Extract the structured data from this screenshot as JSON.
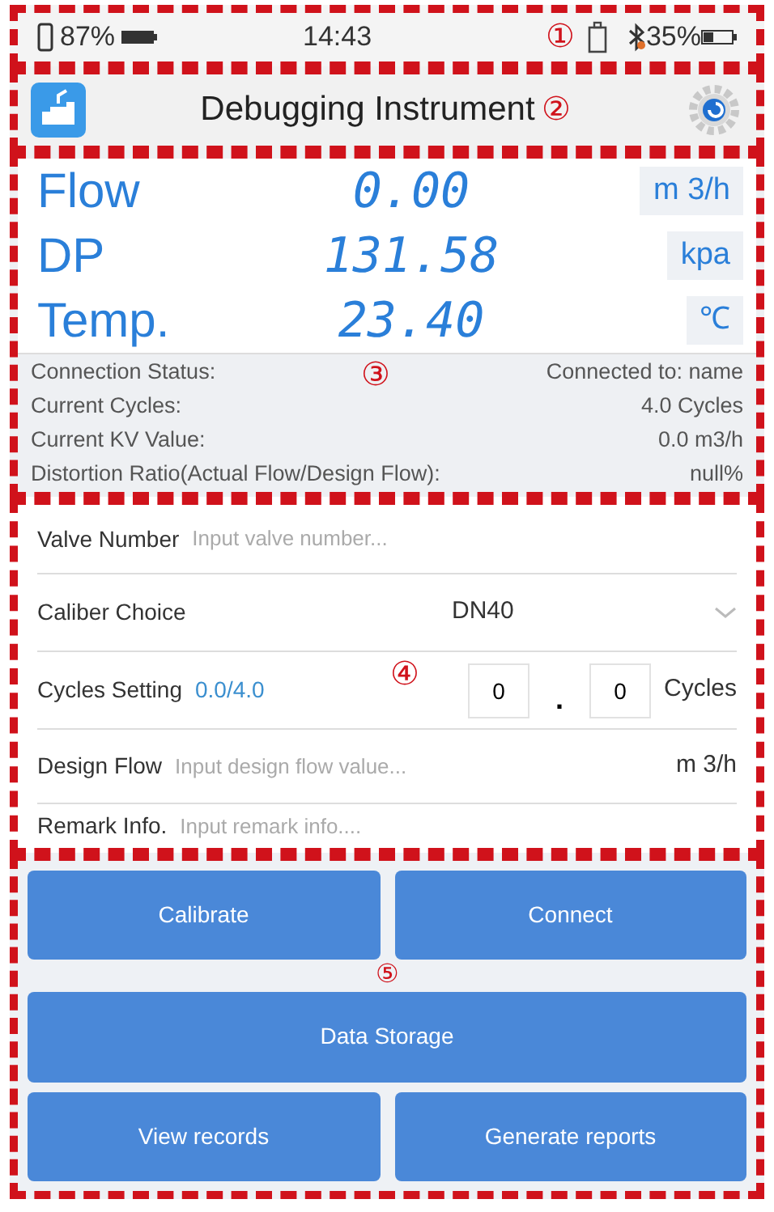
{
  "status_bar": {
    "marker": "①",
    "phone_battery": "87%",
    "time": "14:43",
    "device_battery": "35%"
  },
  "header": {
    "title": "Debugging Instrument",
    "marker": "②"
  },
  "monitor": {
    "marker": "③",
    "readings": [
      {
        "label": "Flow",
        "value": "0.00",
        "unit": "m 3/h"
      },
      {
        "label": "DP",
        "value": "131.58",
        "unit": "kpa"
      },
      {
        "label": "Temp.",
        "value": "23.40",
        "unit": "℃"
      }
    ],
    "info": [
      {
        "label": "Connection Status:",
        "value": "Connected to: name"
      },
      {
        "label": "Current Cycles:",
        "value": "4.0 Cycles"
      },
      {
        "label": "Current KV Value:",
        "value": "0.0 m3/h"
      },
      {
        "label": "Distortion Ratio(Actual Flow/Design Flow):",
        "value": "null%"
      }
    ]
  },
  "form": {
    "marker": "④",
    "valve_number": {
      "label": "Valve Number",
      "placeholder": "Input valve number..."
    },
    "caliber": {
      "label": "Caliber Choice",
      "value": "DN40"
    },
    "cycles": {
      "label": "Cycles Setting",
      "progress": "0.0/4.0",
      "whole": "0",
      "separator": ".",
      "decimal": "0",
      "unit": "Cycles"
    },
    "design_flow": {
      "label": "Design Flow",
      "placeholder": "Input design flow value...",
      "unit": "m 3/h"
    },
    "remark": {
      "label": "Remark Info.",
      "placeholder": "Input remark info...."
    }
  },
  "actions": {
    "marker": "⑤",
    "rows": [
      {
        "buttons": [
          "Calibrate",
          "Connect"
        ]
      },
      {
        "buttons": [
          "Data Storage"
        ]
      },
      {
        "buttons": [
          "View records",
          "Generate reports"
        ]
      }
    ]
  }
}
